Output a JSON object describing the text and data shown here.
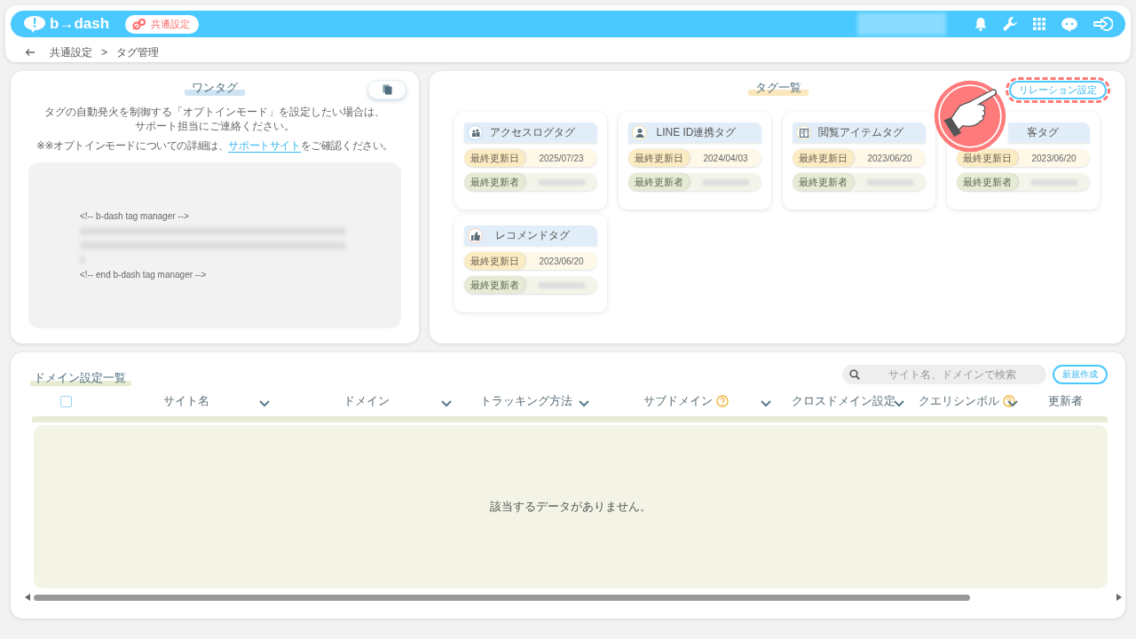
{
  "header": {
    "logo": "b→dash",
    "section_badge": "共通設定"
  },
  "breadcrumb": {
    "items": [
      "共通設定",
      "タグ管理"
    ],
    "separator": ">"
  },
  "one_tag": {
    "title": "ワンタグ",
    "description_lines": [
      "タグの自動発火を制御する「オプトインモード」を設定したい場合は、",
      "サポート担当にご連絡ください。"
    ],
    "note_before": "※※オプトインモードについての詳細は、",
    "note_link": "サポートサイト",
    "note_after": "をご確認ください。",
    "code_first_line": "<!-- b-dash tag manager -->",
    "code_last_line": "<!-- end b-dash tag manager -->"
  },
  "tag_list": {
    "title": "タグ一覧",
    "relation_button": "リレーション設定",
    "cards": [
      {
        "title": "アクセスログタグ",
        "kind": "access",
        "date_label": "最終更新日",
        "date": "2025/07/23",
        "author_label": "最終更新者"
      },
      {
        "title": "LINE ID連携タグ",
        "kind": "user",
        "date_label": "最終更新日",
        "date": "2024/04/03",
        "author_label": "最終更新者"
      },
      {
        "title": "閲覧アイテムタグ",
        "kind": "item",
        "date_label": "最終更新日",
        "date": "2023/06/20",
        "author_label": "最終更新者"
      },
      {
        "title": "客タグ",
        "kind": "hidden",
        "date_label": "最終更新日",
        "date": "2023/06/20",
        "author_label": "最終更新者"
      },
      {
        "title": "レコメンドタグ",
        "kind": "recommend",
        "date_label": "最終更新日",
        "date": "2023/06/20",
        "author_label": "最終更新者"
      }
    ]
  },
  "domains": {
    "title": "ドメイン設定一覧",
    "search_placeholder": "サイト名、ドメインで検索",
    "new_button": "新規作成",
    "select_all_checked": false,
    "columns": [
      {
        "label": "サイト名",
        "help": false,
        "sortable": true
      },
      {
        "label": "ドメイン",
        "help": false,
        "sortable": true
      },
      {
        "label": "トラッキング方法",
        "help": false,
        "sortable": true
      },
      {
        "label": "サブドメイン",
        "help": true,
        "sortable": true
      },
      {
        "label": "クロスドメイン設定",
        "help": false,
        "sortable": true
      },
      {
        "label": "クエリシンボル",
        "help": true,
        "sortable": true
      },
      {
        "label": "更新者",
        "help": false,
        "sortable": false
      }
    ],
    "empty_message": "該当するデータがありません。"
  }
}
